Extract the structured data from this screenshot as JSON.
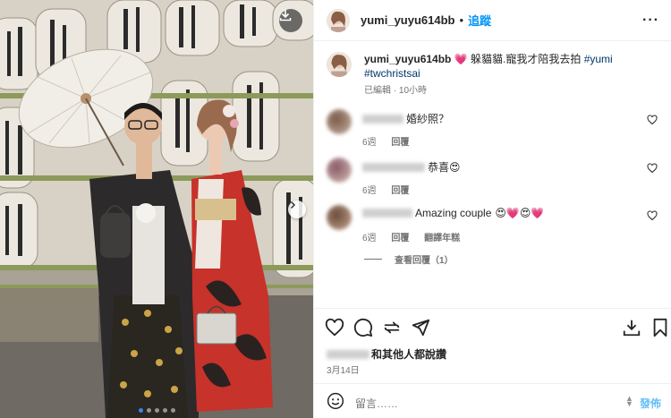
{
  "post": {
    "username": "yumi_yuyu614bb",
    "separator": "•",
    "follow_label": "追蹤",
    "more_label": "···"
  },
  "caption": {
    "username": "yumi_yuyu614bb",
    "emoji": "💗",
    "text": "躲貓貓.寵我才陪我去拍",
    "hashtags": [
      "#yumi",
      "#twchristsai"
    ],
    "edited_label": "已編輯",
    "time_ago": "10小時"
  },
  "comments": [
    {
      "text": "婚紗照？",
      "emojis": "",
      "age": "6週",
      "reply_label": "回覆",
      "translate_label": ""
    },
    {
      "text": "恭喜",
      "emojis": "😍",
      "age": "6週",
      "reply_label": "回覆",
      "translate_label": ""
    },
    {
      "text": "Amazing couple",
      "emojis": "😍💗😍💗",
      "age": "6週",
      "reply_label": "回覆",
      "translate_label": "翻譯年糕"
    }
  ],
  "view_replies_label": "查看回覆（1）",
  "likes_text": "和其他人都說讚",
  "post_date": "3月14日",
  "composer": {
    "placeholder": "留言……",
    "post_label": "發佈"
  },
  "colors": {
    "accent": "#0095f6",
    "hashtag": "#00376b",
    "secondary_text": "#737373"
  },
  "carousel": {
    "total_slides": 5,
    "active_slide": 1
  },
  "icons": [
    "download-icon",
    "chevron-right-icon",
    "more-icon",
    "heart-icon",
    "comment-icon",
    "share-icon",
    "send-icon",
    "save-icon",
    "emoji-icon"
  ]
}
